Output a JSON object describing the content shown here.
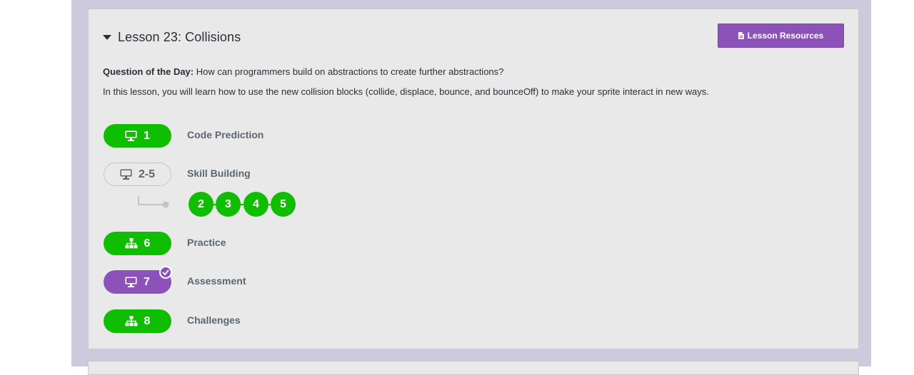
{
  "lesson": {
    "title": "Lesson 23: Collisions",
    "resources_label": "Lesson Resources",
    "question_label": "Question of the Day:",
    "question_text": " How can programmers build on abstractions to create further abstractions?",
    "description": "In this lesson, you will learn how to use the new collision blocks (collide, displace, bounce, and bounceOff) to make your sprite interact in new ways."
  },
  "steps": [
    {
      "number": "1",
      "label": "Code Prediction",
      "icon": "desktop-icon",
      "status": "completed"
    },
    {
      "number": "2-5",
      "label": "Skill Building",
      "icon": "desktop-icon",
      "status": "not-started"
    },
    {
      "number": "6",
      "label": "Practice",
      "icon": "sitemap-icon",
      "status": "completed"
    },
    {
      "number": "7",
      "label": "Assessment",
      "icon": "desktop-icon",
      "status": "submitted"
    },
    {
      "number": "8",
      "label": "Challenges",
      "icon": "sitemap-icon",
      "status": "completed"
    }
  ],
  "sub_levels": [
    "2",
    "3",
    "4",
    "5"
  ],
  "colors": {
    "completed": "#0fbe00",
    "assessment": "#8c52ba",
    "background": "#cfc9de",
    "card": "#e9e9ea"
  }
}
